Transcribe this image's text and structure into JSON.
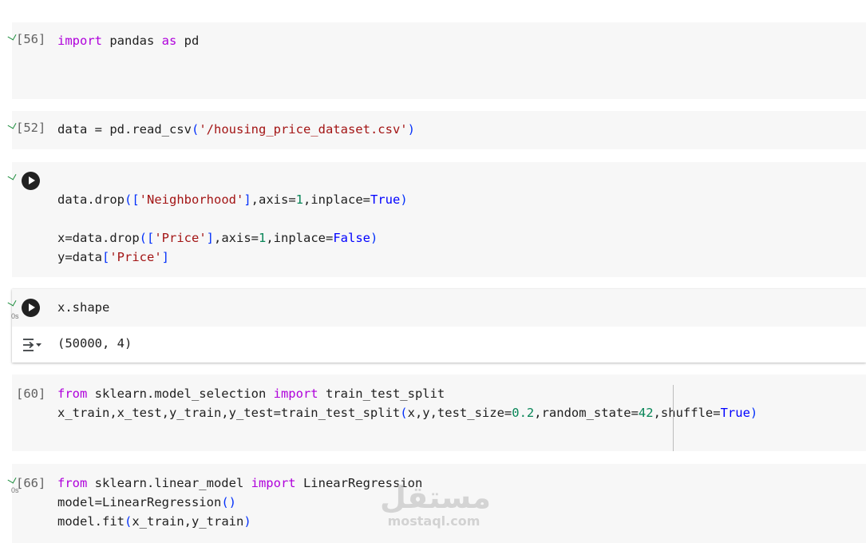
{
  "cells": {
    "c56": {
      "prompt": "[56]",
      "line1": {
        "kw1": "import",
        "t1": " pandas ",
        "kw2": "as",
        "t2": " pd"
      }
    },
    "c52": {
      "prompt": "[52]",
      "line1": {
        "t1": "data = pd.read_csv",
        "p1": "(",
        "s1": "'/housing_price_dataset.csv'",
        "p2": ")"
      }
    },
    "c3": {
      "line1": {
        "t1": "data.drop",
        "p1": "([",
        "s1": "'Neighborhood'",
        "p2": "]",
        "t2": ",axis=",
        "n1": "1",
        "t3": ",inplace=",
        "b1": "True",
        "p3": ")"
      },
      "line2": {
        "t1": "x=data.drop",
        "p1": "([",
        "s1": "'Price'",
        "p2": "]",
        "t2": ",axis=",
        "n1": "1",
        "t3": ",inplace=",
        "b1": "False",
        "p3": ")"
      },
      "line3": {
        "t1": "y=data",
        "p1": "[",
        "s1": "'Price'",
        "p2": "]"
      }
    },
    "c4": {
      "line1": {
        "t1": "x.shape"
      },
      "output": "(50000, 4)",
      "exec_time": "0s"
    },
    "c60": {
      "prompt": "[60]",
      "line1": {
        "kw1": "from",
        "t1": " sklearn.model_selection ",
        "kw2": "import",
        "t2": " train_test_split"
      },
      "line2": {
        "t1": "x_train,x_test,y_train,y_test=train_test_split",
        "p1": "(",
        "t2": "x,y,test_size=",
        "n1": "0.2",
        "t3": ",random_state=",
        "n2": "42",
        "t4": ",shuffle=",
        "b1": "True",
        "p2": ")"
      }
    },
    "c66": {
      "prompt": "[66]",
      "exec_time": "0s",
      "line1": {
        "kw1": "from",
        "t1": " sklearn.linear_model ",
        "kw2": "import",
        "t2": " LinearRegression"
      },
      "line2": {
        "t1": "model=LinearRegression",
        "p1": "()"
      },
      "line3": {
        "t1": "model.fit",
        "p1": "(",
        "t2": "x_train,y_train",
        "p2": ")"
      }
    }
  },
  "watermark": {
    "arabic": "مستقل",
    "latin": "mostaql.com"
  },
  "colors": {
    "keyword": "#af00db",
    "string": "#a31515",
    "number": "#098658",
    "boolean": "#0000ff",
    "bracket": "#0431fa",
    "check": "#1e8e3e"
  }
}
